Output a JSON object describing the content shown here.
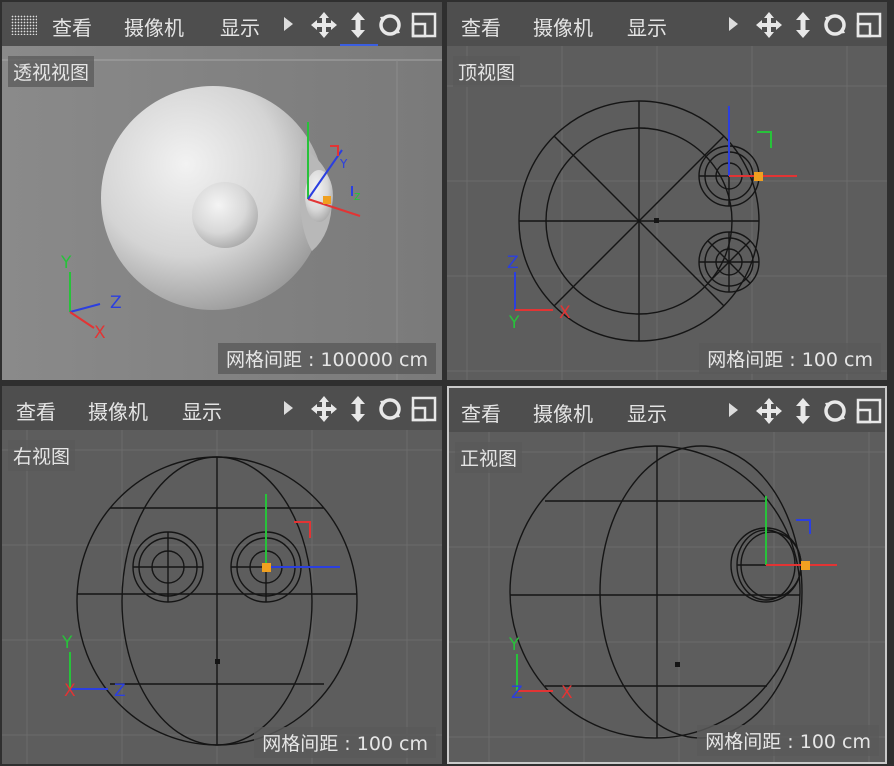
{
  "toolbar": {
    "view": "查看",
    "camera": "摄像机",
    "display": "显示"
  },
  "panes": {
    "perspective": {
      "label": "透视视图",
      "grid": "网格间距 : 100000 cm"
    },
    "top": {
      "label": "顶视图",
      "grid": "网格间距 : 100 cm"
    },
    "right": {
      "label": "右视图",
      "grid": "网格间距 : 100 cm"
    },
    "front": {
      "label": "正视图",
      "grid": "网格间距 : 100 cm"
    }
  },
  "axis": {
    "x": "X",
    "y": "Y",
    "z": "Z"
  },
  "icons": [
    "panel-menu-icon",
    "move-view-icon",
    "zoom-view-icon",
    "rotate-view-icon",
    "maximize-view-icon"
  ],
  "colors": {
    "x_axis": "#e23434",
    "y_axis": "#27c23a",
    "z_axis": "#2b3fe0",
    "handle": "#f0a020"
  }
}
